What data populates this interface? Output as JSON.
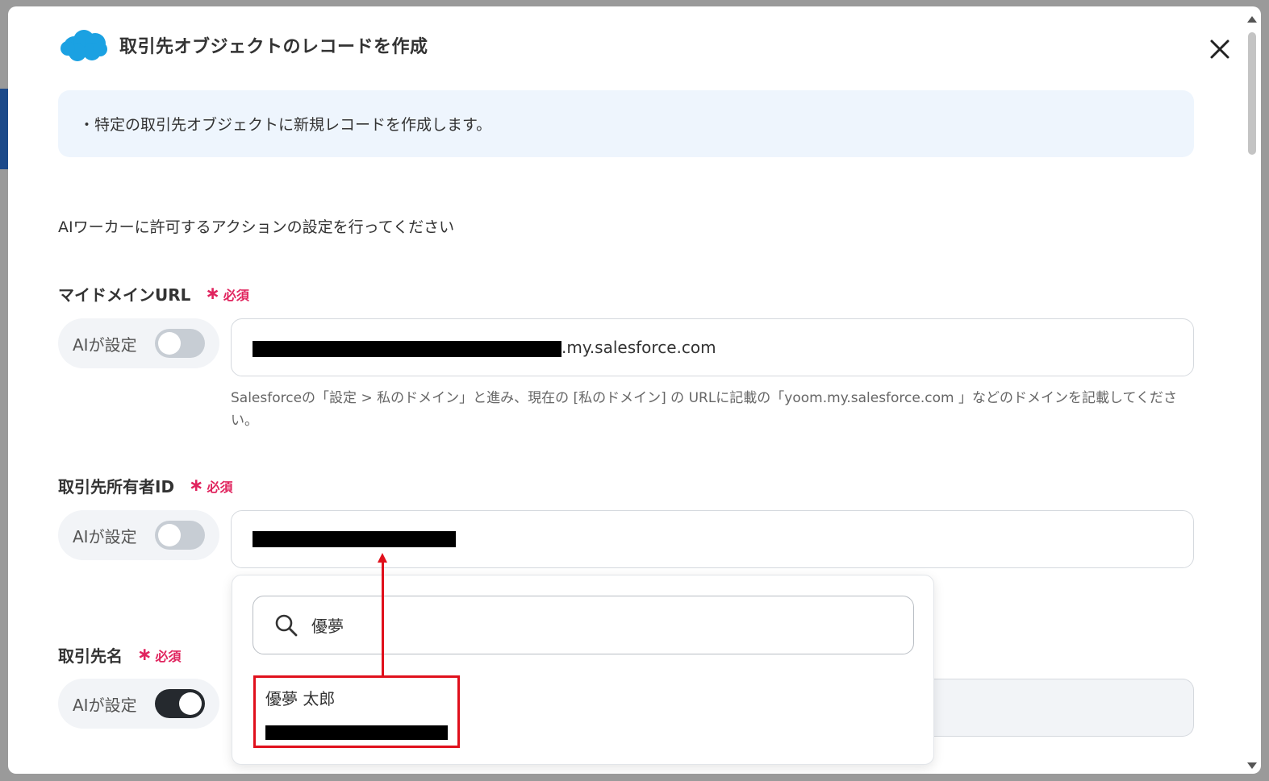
{
  "modal": {
    "title": "取引先オブジェクトのレコードを作成",
    "info": "・特定の取引先オブジェクトに新規レコードを作成します。",
    "section_description": "AIワーカーに許可するアクションの設定を行ってください",
    "brand_color": "#1ba1e2",
    "required_label": "必須",
    "ai_toggle_label": "AIが設定"
  },
  "fields": {
    "domain_url": {
      "label": "マイドメインURL",
      "value_suffix": ".my.salesforce.com",
      "ai_toggle_on": false,
      "helper": "Salesforceの「設定 > 私のドメイン」と進み、現在の [私のドメイン] の URLに記載の「yoom.my.salesforce.com 」などのドメインを記載してください。"
    },
    "owner_id": {
      "label": "取引先所有者ID",
      "ai_toggle_on": false
    },
    "account_name": {
      "label": "取引先名",
      "ai_toggle_on": true
    }
  },
  "dropdown": {
    "search_value": "優夢",
    "options": [
      {
        "name": "優夢 太郎"
      }
    ]
  },
  "colors": {
    "required": "#e0245e",
    "annotation": "#e0101c",
    "info_bg": "#eef5fd"
  }
}
